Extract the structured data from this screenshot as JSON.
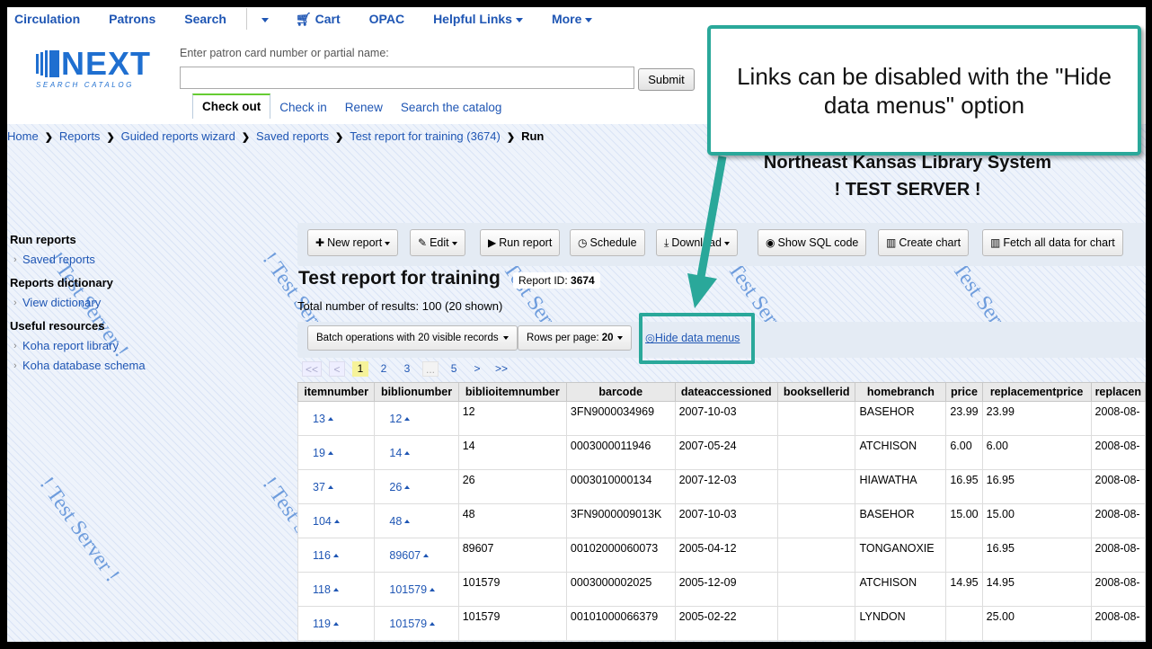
{
  "topnav": {
    "items": [
      {
        "label": "Circulation",
        "dropdown": false
      },
      {
        "label": "Patrons",
        "dropdown": false
      },
      {
        "label": "Search",
        "dropdown": false
      }
    ],
    "items2": [
      {
        "label": "Cart",
        "icon": "cart-icon",
        "dropdown": false
      },
      {
        "label": "OPAC",
        "dropdown": false
      },
      {
        "label": "Helpful Links",
        "dropdown": true
      },
      {
        "label": "More",
        "dropdown": true
      }
    ]
  },
  "logo": {
    "main": "NEXT",
    "sub": "SEARCH CATALOG"
  },
  "patron_search": {
    "label": "Enter patron card number or partial name:",
    "value": "",
    "submit": "Submit"
  },
  "circ_tabs": [
    "Check out",
    "Check in",
    "Renew",
    "Search the catalog"
  ],
  "breadcrumb": {
    "items": [
      "Home",
      "Reports",
      "Guided reports wizard",
      "Saved reports",
      "Test report for training (3674)"
    ],
    "current": "Run"
  },
  "server": {
    "line1": "Northeast Kansas Library System",
    "line2": "! TEST SERVER !"
  },
  "watermark": "! Test Server !",
  "sidebar": {
    "sections": [
      {
        "title": "Run reports",
        "links": [
          "Saved reports"
        ]
      },
      {
        "title": "Reports dictionary",
        "links": [
          "View dictionary"
        ]
      },
      {
        "title": "Useful resources",
        "links": [
          "Koha report library",
          "Koha database schema"
        ]
      }
    ]
  },
  "toolbar": {
    "new_report": "New report",
    "edit": "Edit",
    "run_report": "Run report",
    "schedule": "Schedule",
    "download": "Download",
    "show_sql": "Show SQL code",
    "create_chart": "Create chart",
    "fetch_chart": "Fetch all data for chart"
  },
  "report": {
    "title": "Test report for training",
    "id_label": "Report ID:",
    "id": "3674",
    "total": "Total number of results: 100 (20 shown)"
  },
  "batch": {
    "batch_label": "Batch operations with 20 visible records",
    "rpp_label": "Rows per page:",
    "rpp_value": "20",
    "hide_menus": "Hide data menus"
  },
  "pager": [
    "<<",
    "<",
    "1",
    "2",
    "3",
    "...",
    "5",
    ">",
    ">>"
  ],
  "table": {
    "columns": [
      "itemnumber",
      "biblionumber",
      "biblioitemnumber",
      "barcode",
      "dateaccessioned",
      "booksellerid",
      "homebranch",
      "price",
      "replacementprice",
      "replacen"
    ],
    "rows": [
      [
        "13",
        "12",
        "12",
        "3FN9000034969",
        "2007-10-03",
        "",
        "BASEHOR",
        "23.99",
        "23.99",
        "2008-08-"
      ],
      [
        "19",
        "14",
        "14",
        "0003000011946",
        "2007-05-24",
        "",
        "ATCHISON",
        "6.00",
        "6.00",
        "2008-08-"
      ],
      [
        "37",
        "26",
        "26",
        "0003010000134",
        "2007-12-03",
        "",
        "HIAWATHA",
        "16.95",
        "16.95",
        "2008-08-"
      ],
      [
        "104",
        "48",
        "48",
        "3FN9000009013K",
        "2007-10-03",
        "",
        "BASEHOR",
        "15.00",
        "15.00",
        "2008-08-"
      ],
      [
        "116",
        "89607",
        "89607",
        "00102000060073",
        "2005-04-12",
        "",
        "TONGANOXIE",
        "",
        "16.95",
        "2008-08-"
      ],
      [
        "118",
        "101579",
        "101579",
        "0003000002025",
        "2005-12-09",
        "",
        "ATCHISON",
        "14.95",
        "14.95",
        "2008-08-"
      ],
      [
        "119",
        "101579",
        "101579",
        "00101000066379",
        "2005-02-22",
        "",
        "LYNDON",
        "",
        "25.00",
        "2008-08-"
      ]
    ]
  },
  "callout": {
    "text": "Links can be disabled with the \"Hide data menus\" option"
  },
  "colors": {
    "link": "#1f56b4",
    "callout_border": "#2aa89a",
    "toolbar_bg": "#e4ebf4"
  }
}
